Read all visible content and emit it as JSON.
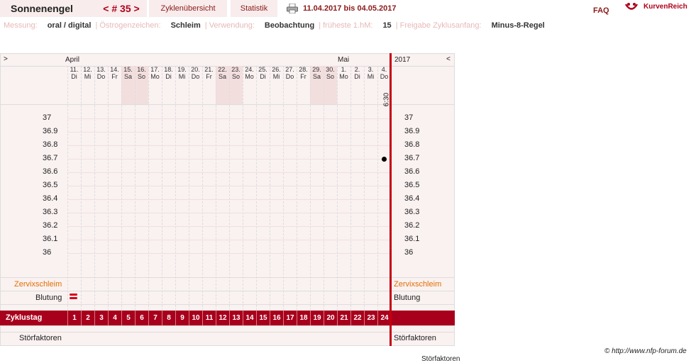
{
  "header": {
    "user_name": "Sonnenengel",
    "cycle_label": "< # 35 >",
    "tabs": [
      "Zyklenübersicht",
      "Statistik"
    ],
    "date_range": "11.04.2017 bis 04.05.2017",
    "faq": "FAQ",
    "logo": "KurvenReich",
    "printer_icon": "printer-icon"
  },
  "settings": [
    {
      "key": "Messung:",
      "value": "oral / digital"
    },
    {
      "key": "Östrogenzeichen:",
      "value": "Schleim"
    },
    {
      "key": "Verwendung:",
      "value": "Beobachtung"
    },
    {
      "key": "früheste 1.hM:",
      "value": "15"
    },
    {
      "key": "Freigabe Zyklusanfang:",
      "value": "Minus-8-Regel"
    }
  ],
  "chart": {
    "left_arrow": ">",
    "right_arrow": "<",
    "month_april": "April",
    "month_mai": "Mai",
    "year": "2017",
    "days": [
      {
        "d": "11.",
        "w": "Di"
      },
      {
        "d": "12.",
        "w": "Mi"
      },
      {
        "d": "13.",
        "w": "Do"
      },
      {
        "d": "14.",
        "w": "Fr"
      },
      {
        "d": "15.",
        "w": "Sa",
        "we": true
      },
      {
        "d": "16.",
        "w": "So",
        "we": true
      },
      {
        "d": "17.",
        "w": "Mo"
      },
      {
        "d": "18.",
        "w": "Di"
      },
      {
        "d": "19.",
        "w": "Mi"
      },
      {
        "d": "20.",
        "w": "Do"
      },
      {
        "d": "21.",
        "w": "Fr"
      },
      {
        "d": "22.",
        "w": "Sa",
        "we": true
      },
      {
        "d": "23.",
        "w": "So",
        "we": true
      },
      {
        "d": "24.",
        "w": "Mo"
      },
      {
        "d": "25.",
        "w": "Di"
      },
      {
        "d": "26.",
        "w": "Mi"
      },
      {
        "d": "27.",
        "w": "Do"
      },
      {
        "d": "28.",
        "w": "Fr"
      },
      {
        "d": "29.",
        "w": "Sa",
        "we": true
      },
      {
        "d": "30.",
        "w": "So",
        "we": true
      },
      {
        "d": "1.",
        "w": "Mo"
      },
      {
        "d": "2.",
        "w": "Di"
      },
      {
        "d": "3.",
        "w": "Mi"
      },
      {
        "d": "4.",
        "w": "Do"
      }
    ],
    "time_last_day": "6:30",
    "y_ticks": [
      "37",
      "36.9",
      "36.8",
      "36.7",
      "36.6",
      "36.5",
      "36.4",
      "36.3",
      "36.2",
      "36.1",
      "36"
    ],
    "temperature_points": [
      {
        "day_index": 23,
        "value": 36.7
      }
    ],
    "bleeding_day_index": 0,
    "labels": {
      "zervix": "Zervixschleim",
      "blutung": "Blutung",
      "zyklustag": "Zyklustag",
      "stoer": "Störfaktoren"
    },
    "cycle_days": [
      "1",
      "2",
      "3",
      "4",
      "5",
      "6",
      "7",
      "8",
      "9",
      "10",
      "11",
      "12",
      "13",
      "14",
      "15",
      "16",
      "17",
      "18",
      "19",
      "20",
      "21",
      "22",
      "23",
      "24"
    ]
  },
  "footer": {
    "copyright": "© http://www.nfp-forum.de",
    "stoer_overflow": "Störfaktoren"
  },
  "colors": {
    "accent": "#a8001c",
    "line": "#c40010",
    "zervix": "#e07000"
  }
}
